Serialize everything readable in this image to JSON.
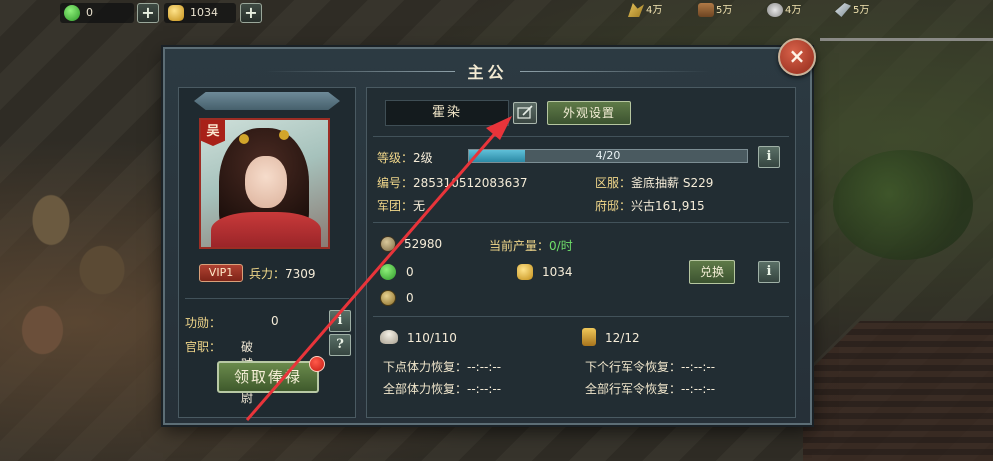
{
  "topbar": {
    "jade": {
      "value": "0",
      "icon": "jade-icon"
    },
    "gold": {
      "value": "1034",
      "icon": "gold-ingot-icon"
    },
    "resources": [
      {
        "icon": "grain-icon",
        "value": "4万"
      },
      {
        "icon": "wood-icon",
        "value": "5万"
      },
      {
        "icon": "stone-icon",
        "value": "4万"
      },
      {
        "icon": "iron-icon",
        "value": "5万"
      }
    ]
  },
  "panel": {
    "title": "主公",
    "close_label": "×"
  },
  "profile": {
    "faction": "吴",
    "vip": "VIP1",
    "troops_label": "兵力：",
    "troops_value": "7309",
    "merit_label": "功勋：",
    "merit_value": "0",
    "office_label": "官职：",
    "office_value": "破贼校尉",
    "salary_button": "领取俸禄"
  },
  "lord": {
    "name": "霍染",
    "appearance_button": "外观设置",
    "level_label": "等级：",
    "level_value": "2级",
    "progress": {
      "current": 4,
      "max": 20,
      "text": "4/20"
    },
    "id_label": "编号：",
    "id_value": "285310512083637",
    "server_label": "区服：",
    "server_value": "釜底抽薪 S229",
    "legion_label": "军团：",
    "legion_value": "无",
    "mansion_label": "府邸：",
    "mansion_value": "兴古161,915"
  },
  "economy": {
    "copper_value": "52980",
    "output_label": "当前产量：",
    "output_value": "0/时",
    "jade_value": "0",
    "gold_value": "1034",
    "exchange_button": "兑换",
    "token_value": "0"
  },
  "stamina": {
    "stamina_value": "110/110",
    "orders_value": "12/12",
    "next_stamina_label": "下点体力恢复：",
    "next_stamina_value": "--:--:--",
    "all_stamina_label": "全部体力恢复：",
    "all_stamina_value": "--:--:--",
    "next_order_label": "下个行军令恢复：",
    "next_order_value": "--:--:--",
    "all_order_label": "全部行军令恢复：",
    "all_order_value": "--:--:--"
  },
  "info_label": "i",
  "help_label": "?",
  "colors": {
    "accent_gold": "#f0d68a",
    "green_value": "#6fe06a",
    "arrow_red": "#e8343a"
  }
}
